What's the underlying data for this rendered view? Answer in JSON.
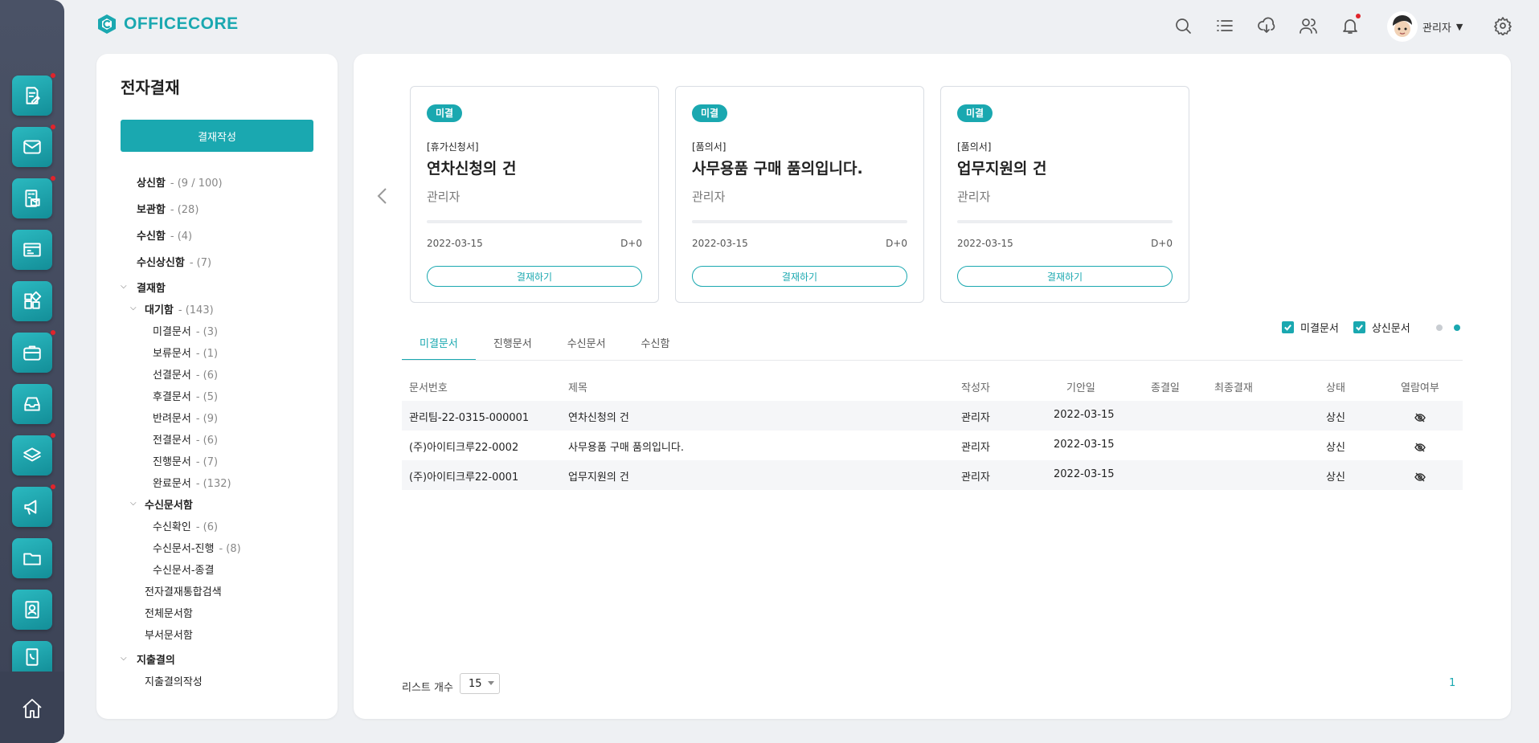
{
  "brand": {
    "name": "OFFICECORE",
    "color": "#1aa8b0"
  },
  "rail": {
    "items": [
      {
        "icon": "approval-doc-icon",
        "badge": true
      },
      {
        "icon": "mail-icon",
        "badge": true
      },
      {
        "icon": "building-mail-icon",
        "badge": true
      },
      {
        "icon": "board-icon",
        "badge": false
      },
      {
        "icon": "apps-icon",
        "badge": false
      },
      {
        "icon": "briefcase-icon",
        "badge": true
      },
      {
        "icon": "inbox-icon",
        "badge": false
      },
      {
        "icon": "layers-icon",
        "badge": true
      },
      {
        "icon": "megaphone-icon",
        "badge": true
      },
      {
        "icon": "folder-icon",
        "badge": false
      },
      {
        "icon": "contacts-icon",
        "badge": false
      },
      {
        "icon": "phonebook-icon",
        "badge": false
      }
    ],
    "home_icon": "home-icon"
  },
  "header": {
    "icons": [
      "search-icon",
      "list-icon",
      "cloud-download-icon",
      "users-icon",
      "bell-icon",
      "settings-icon"
    ],
    "user_name": "관리자",
    "user_caret": "▼"
  },
  "sidebar": {
    "title": "전자결재",
    "compose_label": "결재작성",
    "items": [
      {
        "name": "상신함",
        "count": "- (9 / 100)"
      },
      {
        "name": "보관함",
        "count": "- (28)"
      },
      {
        "name": "수신함",
        "count": "- (4)"
      },
      {
        "name": "수신상신함",
        "count": "- (7)"
      },
      {
        "name": "결재함",
        "count": ""
      },
      {
        "name": "대기함",
        "count": "- (143)"
      },
      {
        "name": "미결문서",
        "count": "- (3)"
      },
      {
        "name": "보류문서",
        "count": "- (1)"
      },
      {
        "name": "선결문서",
        "count": "- (6)"
      },
      {
        "name": "후결문서",
        "count": "- (5)"
      },
      {
        "name": "반려문서",
        "count": "- (9)"
      },
      {
        "name": "전결문서",
        "count": "- (6)"
      },
      {
        "name": "진행문서",
        "count": "- (7)"
      },
      {
        "name": "완료문서",
        "count": "- (132)"
      },
      {
        "name": "수신문서함",
        "count": ""
      },
      {
        "name": "수신확인",
        "count": "- (6)"
      },
      {
        "name": "수신문서-진행",
        "count": "- (8)"
      },
      {
        "name": "수신문서-종결",
        "count": ""
      },
      {
        "name": "전자결재통합검색",
        "count": ""
      },
      {
        "name": "전체문서함",
        "count": ""
      },
      {
        "name": "부서문서함",
        "count": ""
      },
      {
        "name": "지출결의",
        "count": ""
      },
      {
        "name": "지출결의작성",
        "count": ""
      }
    ]
  },
  "cards": [
    {
      "badge": "미결",
      "form": "[휴가신청서]",
      "subject": "연차신청의 건",
      "drafter": "관리자",
      "progress": 0,
      "date": "2022-03-15",
      "dday": "D+0",
      "action": "결재하기"
    },
    {
      "badge": "미결",
      "form": "[품의서]",
      "subject": "사무용품 구매 품의입니다.",
      "drafter": "관리자",
      "progress": 0,
      "date": "2022-03-15",
      "dday": "D+0",
      "action": "결재하기"
    },
    {
      "badge": "미결",
      "form": "[품의서]",
      "subject": "업무지원의 건",
      "drafter": "관리자",
      "progress": 0,
      "date": "2022-03-15",
      "dday": "D+0",
      "action": "결재하기"
    }
  ],
  "filters": {
    "pending": {
      "label": "미결문서",
      "checked": true
    },
    "submitted": {
      "label": "상신문서",
      "checked": true
    },
    "pager_dots": [
      {
        "active": false
      },
      {
        "active": true
      }
    ]
  },
  "tabs": [
    {
      "label": "미결문서",
      "active": true
    },
    {
      "label": "진행문서",
      "active": false
    },
    {
      "label": "수신문서",
      "active": false
    },
    {
      "label": "수신함",
      "active": false
    }
  ],
  "table": {
    "columns": [
      "문서번호",
      "제목",
      "작성자",
      "기안일",
      "종결일",
      "최종결재",
      "상태",
      "열람여부"
    ],
    "rows": [
      {
        "doc_no": "관리팀-22-0315-000001",
        "title": "연차신청의 건",
        "author": "관리자",
        "draft_date": "2022-03-15",
        "close_date": "",
        "final_approver": "",
        "status": "상신",
        "read_icon": "eye-off-icon"
      },
      {
        "doc_no": "(주)아이티크루22-0002",
        "title": "사무용품 구매 품의입니다.",
        "author": "관리자",
        "draft_date": "2022-03-15",
        "close_date": "",
        "final_approver": "",
        "status": "상신",
        "read_icon": "eye-off-icon"
      },
      {
        "doc_no": "(주)아이티크루22-0001",
        "title": "업무지원의 건",
        "author": "관리자",
        "draft_date": "2022-03-15",
        "close_date": "",
        "final_approver": "",
        "status": "상신",
        "read_icon": "eye-off-icon"
      }
    ]
  },
  "footer": {
    "list_count_label": "리스트 개수",
    "list_count_value": "15",
    "page": "1"
  }
}
